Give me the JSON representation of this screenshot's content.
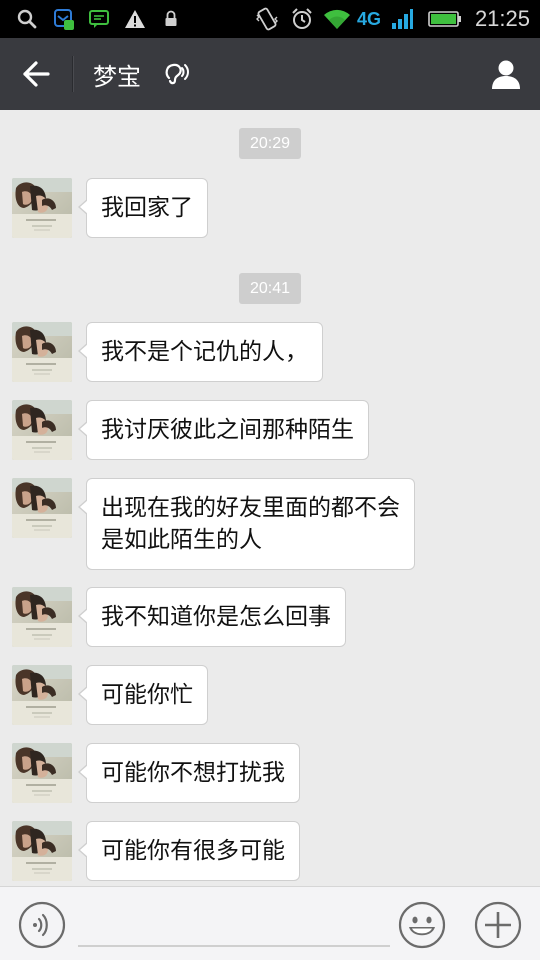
{
  "status_bar": {
    "time": "21:25",
    "network": "4G",
    "icons": [
      "search-icon",
      "mail-icon",
      "chat-icon",
      "warning-icon",
      "lock-icon",
      "vibrate-icon",
      "alarm-icon",
      "wifi-icon",
      "signal-icon",
      "battery-icon"
    ]
  },
  "header": {
    "title": "梦宝",
    "back_icon": "back-arrow-icon",
    "earpiece_icon": "earpiece-icon",
    "profile_icon": "person-icon",
    "background": "#393a3f"
  },
  "messages": [
    {
      "type": "time",
      "text": "20:29"
    },
    {
      "type": "received",
      "lines": [
        "我回家了"
      ]
    },
    {
      "type": "time",
      "text": "20:41"
    },
    {
      "type": "received",
      "lines": [
        "我不是个记仇的人，"
      ]
    },
    {
      "type": "received",
      "lines": [
        "我讨厌彼此之间那种陌生"
      ]
    },
    {
      "type": "received",
      "lines": [
        "出现在我的好友里面的都不会",
        "是如此陌生的人"
      ]
    },
    {
      "type": "received",
      "lines": [
        "我不知道你是怎么回事"
      ]
    },
    {
      "type": "received",
      "lines": [
        "可能你忙"
      ]
    },
    {
      "type": "received",
      "lines": [
        "可能你不想打扰我"
      ]
    },
    {
      "type": "received",
      "lines": [
        "可能你有很多可能"
      ]
    }
  ],
  "input_bar": {
    "voice_icon": "voice-icon",
    "emoji_icon": "emoji-icon",
    "plus_icon": "plus-icon",
    "text_value": ""
  },
  "colors": {
    "chat_background": "#ebebeb",
    "bubble": "#ffffff",
    "timestamp_bg": "#cecece",
    "network_accent": "#27a9e1",
    "wifi_accent": "#3fbf3f"
  }
}
